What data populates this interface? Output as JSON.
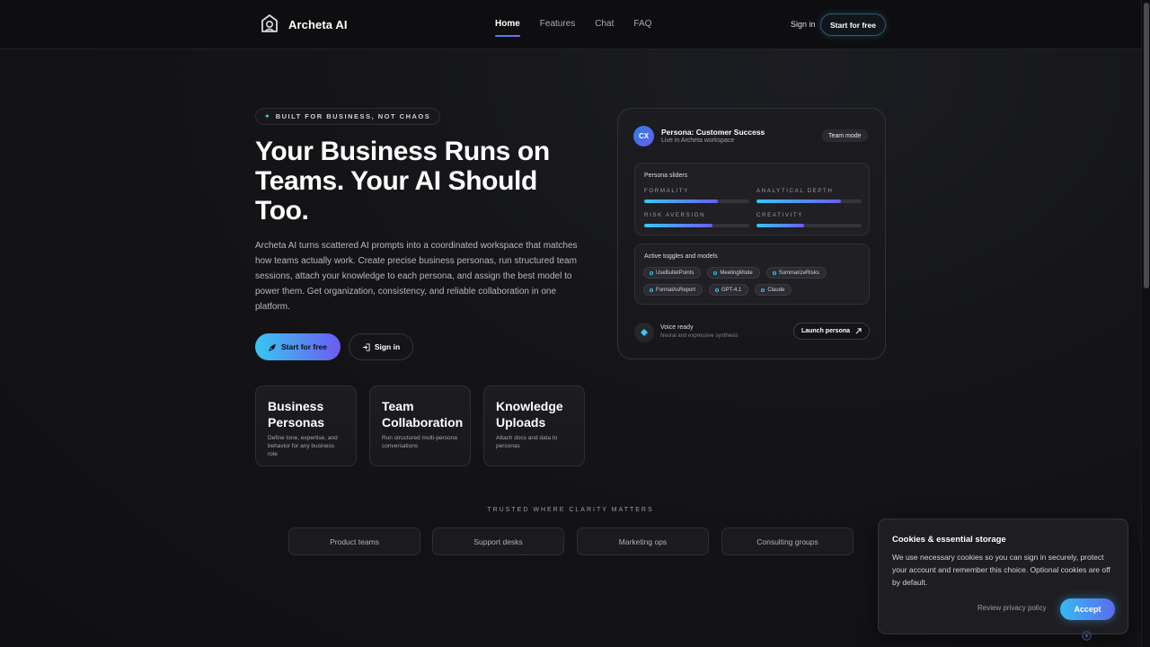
{
  "nav": {
    "brand": "Archeta AI",
    "links": [
      "Home",
      "Features",
      "Chat",
      "FAQ"
    ],
    "sign_in": "Sign in",
    "start": "Start for free"
  },
  "hero": {
    "badge": "BUILT FOR BUSINESS, NOT CHAOS",
    "title": "Your Business Runs on Teams. Your AI Should Too.",
    "description": "Archeta AI turns scattered AI prompts into a coordinated workspace that matches how teams actually work. Create precise business personas, run structured team sessions, attach your knowledge to each persona, and assign the best model to power them. Get organization, consistency, and reliable collaboration in one platform.",
    "primary_cta": "Start for free",
    "secondary_cta": "Sign in"
  },
  "features": [
    {
      "title": "Business Personas",
      "desc": "Define tone, expertise, and behavior for any business role"
    },
    {
      "title": "Team Collaboration",
      "desc": "Run structured multi-persona conversations"
    },
    {
      "title": "Knowledge Uploads",
      "desc": "Attach docs and data to personas"
    }
  ],
  "persona": {
    "avatar": "CX",
    "title": "Persona: Customer Success",
    "subtitle": "Live in Archeta workspace",
    "mode": "Team mode",
    "sliders_title": "Persona sliders",
    "sliders": [
      {
        "label": "FORMALITY",
        "value": 0.7
      },
      {
        "label": "ANALYTICAL DEPTH",
        "value": 0.8
      },
      {
        "label": "RISK AVERSION",
        "value": 0.65
      },
      {
        "label": "CREATIVITY",
        "value": 0.45
      }
    ],
    "toggles_title": "Active toggles and models",
    "tags": [
      "UseBulletPoints",
      "MeetingMode",
      "SummarizeRisks",
      "FormatAsReport",
      "GPT-4.1",
      "Claude"
    ],
    "voice_title": "Voice ready",
    "voice_sub": "Neural and expressive synthesis",
    "launch": "Launch persona"
  },
  "trusted": {
    "heading": "TRUSTED WHERE CLARITY MATTERS",
    "items": [
      "Product teams",
      "Support desks",
      "Marketing ops",
      "Consulting groups"
    ]
  },
  "cookie": {
    "title": "Cookies & essential storage",
    "text": "We use necessary cookies so you can sign in securely, protect your account and remember this choice. Optional cookies are off by default.",
    "link": "Review privacy policy",
    "accept": "Accept"
  },
  "colors": {
    "accent_start": "#38c8ef",
    "accent_end": "#6b5cf0",
    "background": "#141417"
  }
}
